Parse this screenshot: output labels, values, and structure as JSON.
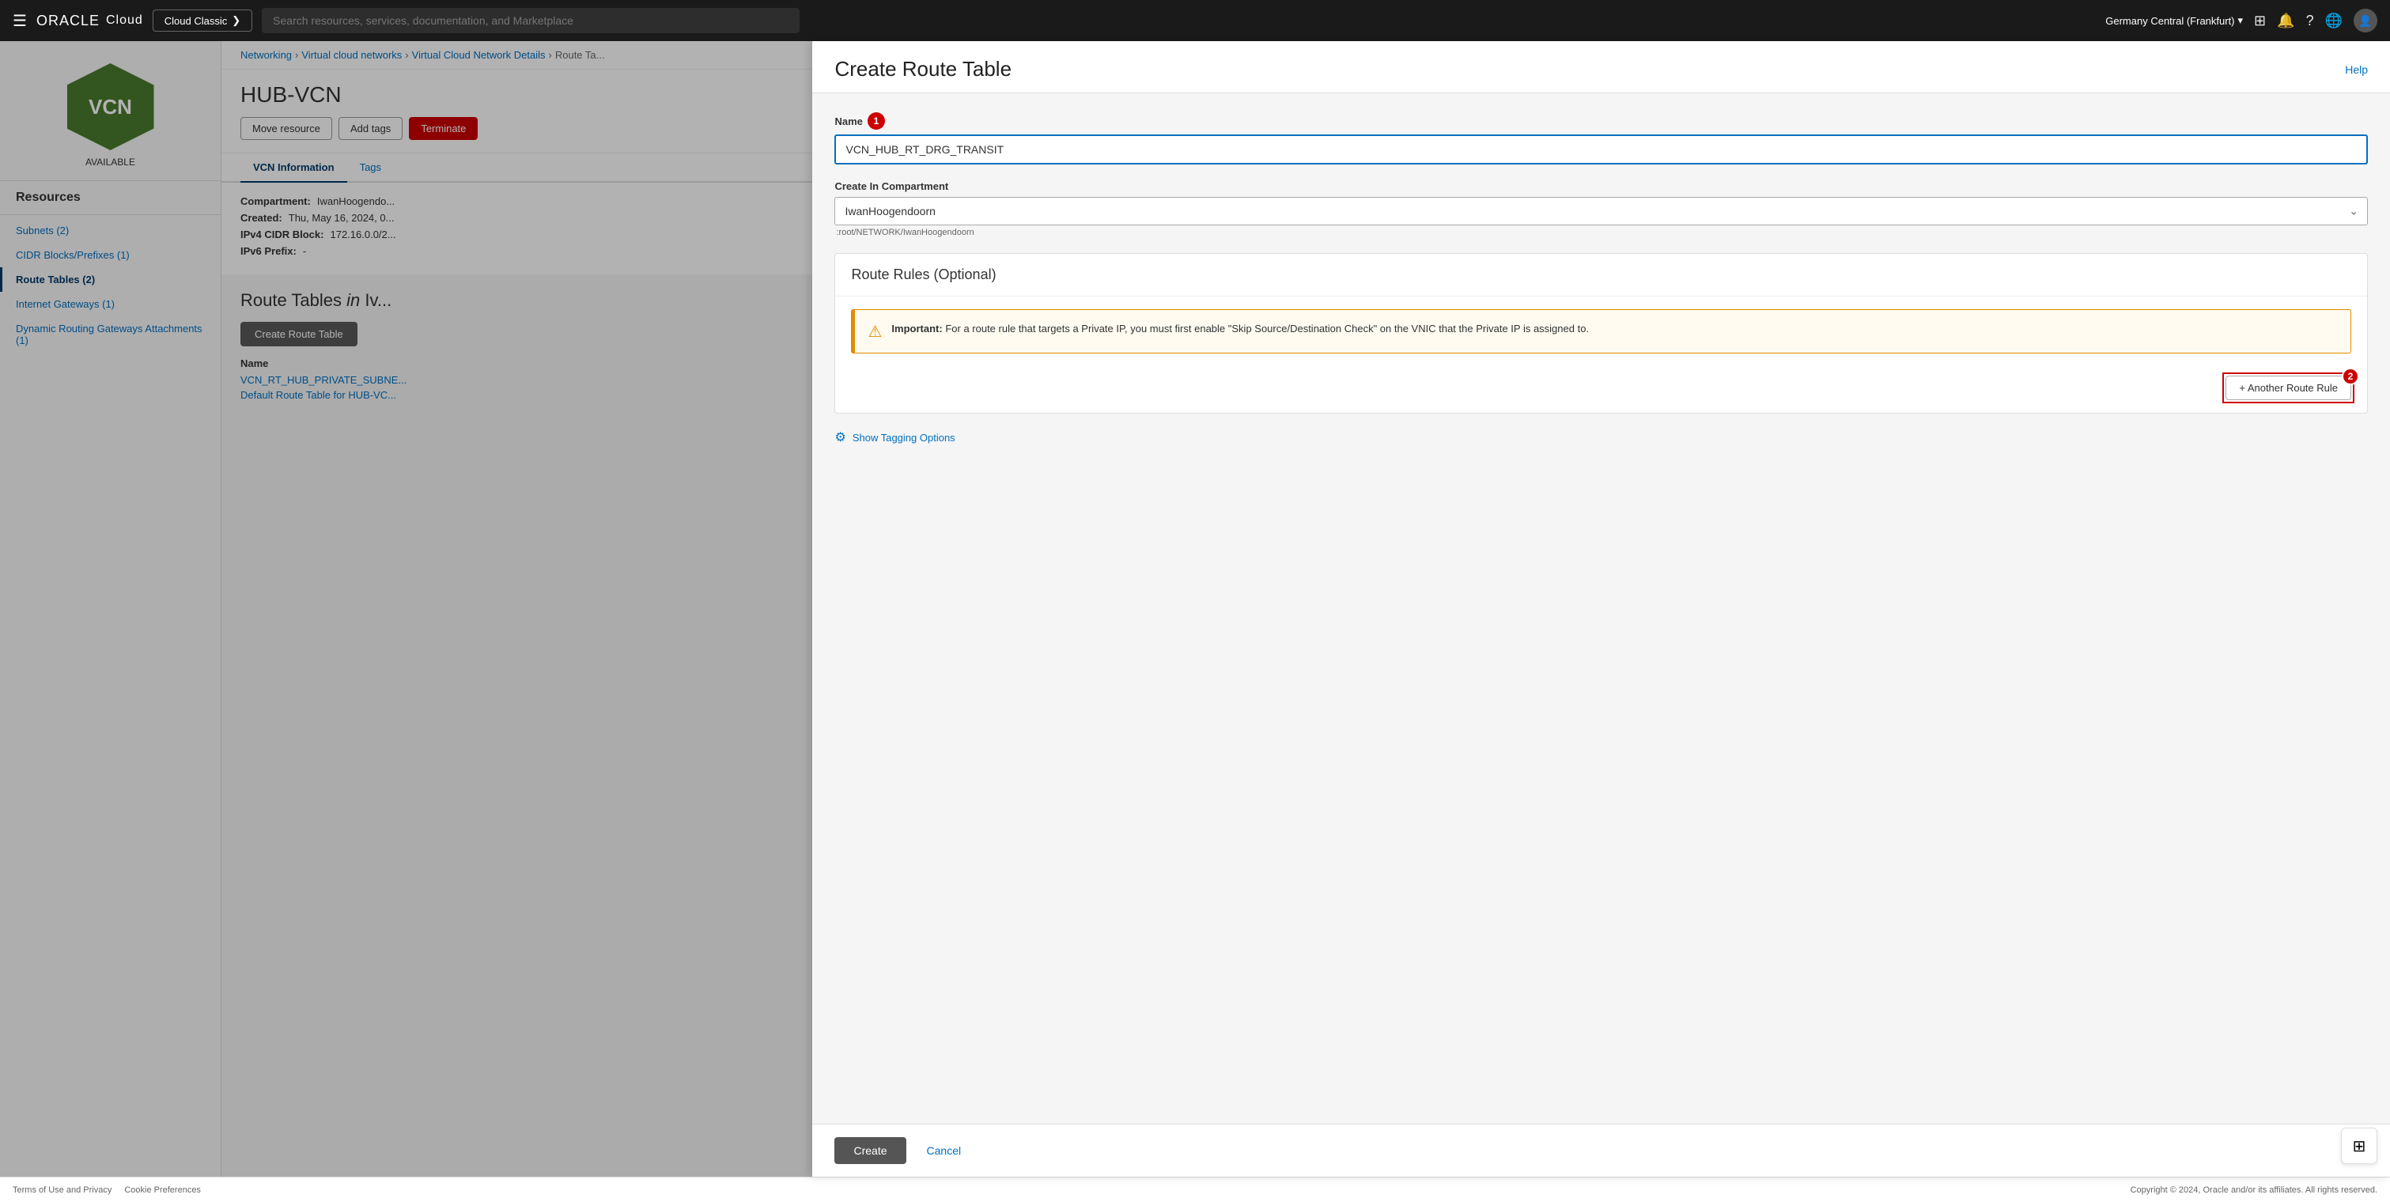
{
  "topnav": {
    "hamburger_label": "☰",
    "oracle_text": "ORACLE",
    "cloud_text": "Cloud",
    "cloud_classic_label": "Cloud Classic",
    "cloud_classic_arrow": "❯",
    "search_placeholder": "Search resources, services, documentation, and Marketplace",
    "region_label": "Germany Central (Frankfurt)",
    "region_chevron": "▾",
    "icons": {
      "console": "⊞",
      "bell": "🔔",
      "help": "?",
      "globe": "🌐",
      "user": "👤"
    }
  },
  "breadcrumb": {
    "networking": "Networking",
    "sep1": "›",
    "vcn_list": "Virtual cloud networks",
    "sep2": "›",
    "vcn_detail": "Virtual Cloud Network Details",
    "sep3": "›",
    "route_tables": "Route Ta..."
  },
  "sidebar": {
    "vcn_name": "VCN",
    "vcn_status": "AVAILABLE",
    "resources_label": "Resources",
    "items": [
      {
        "id": "subnets",
        "label": "Subnets (2)"
      },
      {
        "id": "cidr",
        "label": "CIDR Blocks/Prefixes (1)"
      },
      {
        "id": "route-tables",
        "label": "Route Tables (2)",
        "active": true
      },
      {
        "id": "internet-gateways",
        "label": "Internet Gateways (1)"
      },
      {
        "id": "dynamic-routing-gateways",
        "label": "Dynamic Routing Gateways Attachments (1)"
      }
    ]
  },
  "page": {
    "vcn_title": "HUB-VCN",
    "actions": {
      "move_resource": "Move resource",
      "add_tags": "Add tags",
      "terminate": "Terminate"
    },
    "tabs": [
      {
        "id": "vcn-info",
        "label": "VCN Information",
        "active": true
      },
      {
        "id": "tags",
        "label": "Tags"
      }
    ],
    "vcn_info": {
      "compartment_label": "Compartment:",
      "compartment_value": "IwanHoogendo...",
      "created_label": "Created:",
      "created_value": "Thu, May 16, 2024, 0...",
      "cidr_label": "IPv4 CIDR Block:",
      "cidr_value": "172.16.0.0/2...",
      "ipv6_label": "IPv6 Prefix:",
      "ipv6_value": "-"
    },
    "route_tables_section": {
      "title_prefix": "Route Tables",
      "title_in": "in",
      "title_vcn": "Iv...",
      "create_btn": "Create Route Table",
      "name_col": "Name",
      "rows": [
        {
          "id": "row1",
          "label": "VCN_RT_HUB_PRIVATE_SUBNE..."
        },
        {
          "id": "row2",
          "label": "Default Route Table for HUB-VC..."
        }
      ]
    }
  },
  "panel": {
    "title": "Create Route Table",
    "help_link": "Help",
    "name_label": "Name",
    "name_badge": "1",
    "name_value": "VCN_HUB_RT_DRG_TRANSIT",
    "name_placeholder": "",
    "compartment_label": "Create In Compartment",
    "compartment_value": "IwanHoogendoorn",
    "compartment_path": ":root/NETWORK/IwanHoogendoorn",
    "route_rules_section": {
      "title": "Route Rules (Optional)",
      "important_heading": "Important:",
      "important_text": "For a route rule that targets a Private IP, you must first enable \"Skip Source/Destination Check\" on the VNIC that the Private IP is assigned to.",
      "another_route_btn": "+ Another Route Rule",
      "another_route_badge": "2"
    },
    "show_tagging_label": "Show Tagging Options",
    "create_btn": "Create",
    "cancel_btn": "Cancel"
  },
  "help_widget": {
    "icon": "⊞"
  },
  "footer": {
    "terms": "Terms of Use and Privacy",
    "cookie": "Cookie Preferences",
    "copyright": "Copyright © 2024, Oracle and/or its affiliates. All rights reserved."
  }
}
